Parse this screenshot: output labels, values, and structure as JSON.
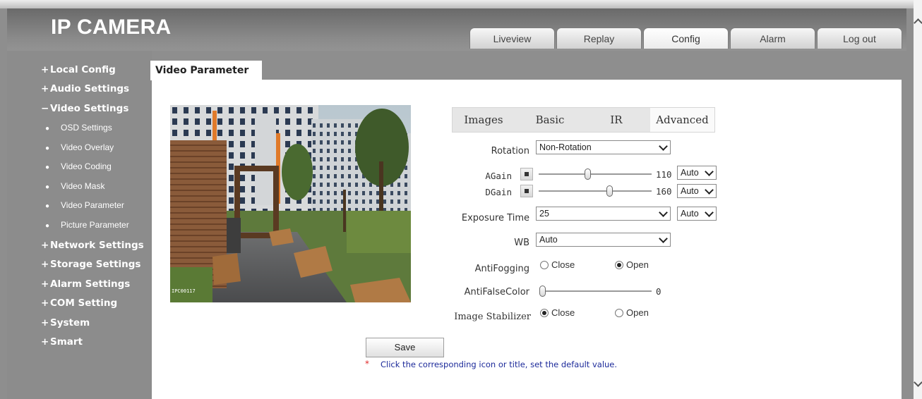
{
  "app": {
    "title": "IP CAMERA"
  },
  "tabs": [
    {
      "label": "Liveview"
    },
    {
      "label": "Replay"
    },
    {
      "label": "Config"
    },
    {
      "label": "Alarm"
    },
    {
      "label": "Log out"
    }
  ],
  "active_tab": "Config",
  "sidebar": {
    "items": [
      {
        "sign": "+",
        "label": "Local Config"
      },
      {
        "sign": "+",
        "label": "Audio Settings"
      },
      {
        "sign": "−",
        "label": "Video Settings"
      },
      {
        "sign": "+",
        "label": "Network Settings"
      },
      {
        "sign": "+",
        "label": "Storage Settings"
      },
      {
        "sign": "+",
        "label": "Alarm Settings"
      },
      {
        "sign": "+",
        "label": "COM Setting"
      },
      {
        "sign": "+",
        "label": "System"
      },
      {
        "sign": "+",
        "label": "Smart"
      }
    ],
    "video_subitems": [
      {
        "label": "OSD Settings"
      },
      {
        "label": "Video Overlay"
      },
      {
        "label": "Video Coding"
      },
      {
        "label": "Video Mask"
      },
      {
        "label": "Video Parameter",
        "selected": true
      },
      {
        "label": "Picture Parameter"
      }
    ]
  },
  "content": {
    "title": "Video Parameter",
    "preview_osd": "IPC00117",
    "param_tabs": [
      {
        "label": "Images"
      },
      {
        "label": "Basic"
      },
      {
        "label": "IR"
      },
      {
        "label": "Advanced"
      }
    ],
    "active_param_tab": "Advanced",
    "rotation": {
      "label": "Rotation",
      "value": "Non-Rotation"
    },
    "again": {
      "label": "AGain",
      "value": "110",
      "max": 255,
      "mode": "Auto"
    },
    "dgain": {
      "label": "DGain",
      "value": "160",
      "max": 255,
      "mode": "Auto"
    },
    "exposure": {
      "label": "Exposure Time",
      "value": "25",
      "mode": "Auto"
    },
    "wb": {
      "label": "WB",
      "value": "Auto"
    },
    "antifogging": {
      "label": "AntiFogging",
      "options": [
        "Close",
        "Open"
      ],
      "selected": "Open"
    },
    "antifalsecolor": {
      "label": "AntiFalseColor",
      "value": "0"
    },
    "stabilizer": {
      "label": "Image Stabilizer",
      "options": [
        "Close",
        "Open"
      ],
      "selected": "Close"
    },
    "save_label": "Save",
    "hint_star": "*",
    "hint": "Click the corresponding icon or title, set the default value."
  },
  "colors": {
    "frame": "#8e8e8e",
    "header": "#6a6a6a",
    "hint_text": "#1c2a9a",
    "hint_star": "#e02a2a"
  },
  "icons": [
    "reset-square-icon",
    "chevron-down-icon",
    "scroll-up-icon",
    "scroll-down-icon"
  ]
}
